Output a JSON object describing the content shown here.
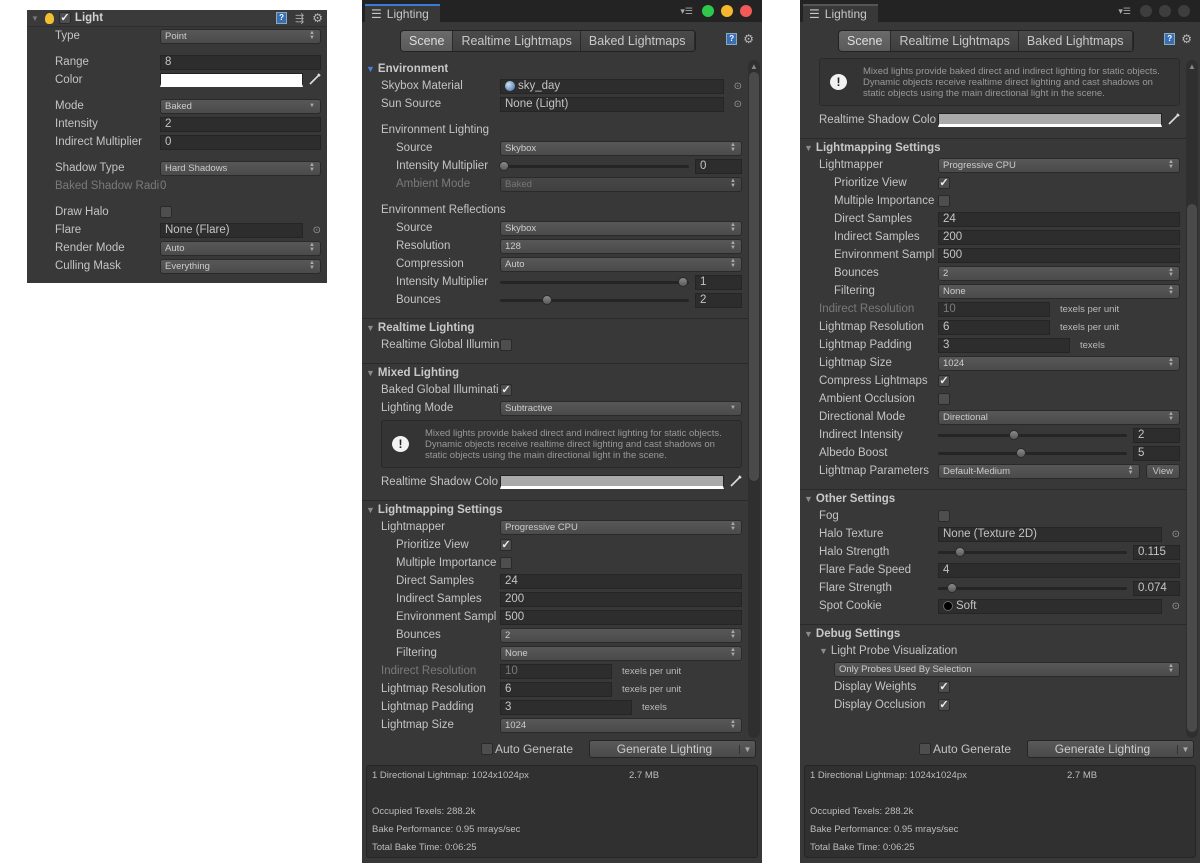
{
  "colors": {
    "accent": "#3b7bd6",
    "close": "#f25a58",
    "minimize": "#f5b72e",
    "maximize": "#2fc84a"
  },
  "inspector": {
    "title": "Light",
    "enabled": true,
    "icons": [
      "foldout-icon",
      "light-bulb-icon",
      "help-book-icon",
      "preset-icon",
      "gear-icon"
    ],
    "rows": [
      {
        "type": "dropdown",
        "label": "Type",
        "indent": 0,
        "value": "Point",
        "arrow": "updown"
      },
      {
        "type": "space"
      },
      {
        "type": "field",
        "label": "Range",
        "indent": 0,
        "value": "8"
      },
      {
        "type": "color",
        "label": "Color",
        "indent": 0,
        "color": "#ffffff"
      },
      {
        "type": "space"
      },
      {
        "type": "dropdown",
        "label": "Mode",
        "indent": 0,
        "value": "Baked",
        "arrow": "down"
      },
      {
        "type": "field",
        "label": "Intensity",
        "indent": 0,
        "value": "2"
      },
      {
        "type": "field",
        "label": "Indirect Multiplier",
        "indent": 0,
        "value": "0"
      },
      {
        "type": "space"
      },
      {
        "type": "dropdown",
        "label": "Shadow Type",
        "indent": 0,
        "value": "Hard Shadows",
        "arrow": "updown"
      },
      {
        "type": "field",
        "label": "Baked Shadow Radi",
        "indent": 1,
        "value": "0",
        "disabled": true,
        "plain": true
      },
      {
        "type": "space"
      },
      {
        "type": "checkbox",
        "label": "Draw Halo",
        "indent": 0,
        "checked": false
      },
      {
        "type": "object",
        "label": "Flare",
        "indent": 0,
        "value": "None (Flare)"
      },
      {
        "type": "dropdown",
        "label": "Render Mode",
        "indent": 0,
        "value": "Auto",
        "arrow": "updown"
      },
      {
        "type": "dropdown",
        "label": "Culling Mask",
        "indent": 0,
        "value": "Everything",
        "arrow": "updown"
      }
    ]
  },
  "mid": {
    "window_tab": "Lighting",
    "tabs": [
      "Scene",
      "Realtime Lightmaps",
      "Baked Lightmaps"
    ],
    "active_tab": "Scene",
    "scroll": {
      "position": 0.0,
      "visible_fraction": 0.62
    },
    "rows": [
      {
        "type": "header",
        "label": "Environment",
        "active": true
      },
      {
        "type": "object",
        "label": "Skybox Material",
        "indent": 1,
        "value": "sky_day",
        "icon": "material-sphere-icon"
      },
      {
        "type": "object",
        "label": "Sun Source",
        "indent": 1,
        "value": "None (Light)"
      },
      {
        "type": "space"
      },
      {
        "type": "label",
        "label": "Environment Lighting",
        "indent": 1
      },
      {
        "type": "dropdown",
        "label": "Source",
        "indent": 2,
        "value": "Skybox",
        "arrow": "updown"
      },
      {
        "type": "slider",
        "label": "Intensity Multiplier",
        "indent": 2,
        "value": "0",
        "position": 0.0
      },
      {
        "type": "dropdown",
        "label": "Ambient Mode",
        "indent": 2,
        "value": "Baked",
        "arrow": "updown",
        "disabled": true
      },
      {
        "type": "space"
      },
      {
        "type": "label",
        "label": "Environment Reflections",
        "indent": 1
      },
      {
        "type": "dropdown",
        "label": "Source",
        "indent": 2,
        "value": "Skybox",
        "arrow": "updown"
      },
      {
        "type": "dropdown",
        "label": "Resolution",
        "indent": 2,
        "value": "128",
        "arrow": "updown"
      },
      {
        "type": "dropdown",
        "label": "Compression",
        "indent": 2,
        "value": "Auto",
        "arrow": "updown"
      },
      {
        "type": "slider",
        "label": "Intensity Multiplier",
        "indent": 2,
        "value": "1",
        "position": 0.97
      },
      {
        "type": "slider",
        "label": "Bounces",
        "indent": 2,
        "value": "2",
        "position": 0.25
      },
      {
        "type": "header",
        "label": "Realtime Lighting"
      },
      {
        "type": "checkbox",
        "label": "Realtime Global Illumin",
        "indent": 1,
        "checked": false
      },
      {
        "type": "header",
        "label": "Mixed Lighting"
      },
      {
        "type": "checkbox",
        "label": "Baked Global Illuminati",
        "indent": 1,
        "checked": true
      },
      {
        "type": "dropdown",
        "label": "Lighting Mode",
        "indent": 1,
        "value": "Subtractive",
        "arrow": "down"
      },
      {
        "type": "helpbox",
        "text": "Mixed lights provide baked direct and indirect lighting for static objects. Dynamic objects receive realtime direct lighting and cast shadows on static objects using the main directional light in the scene."
      },
      {
        "type": "color",
        "label": "Realtime Shadow Colo",
        "indent": 1,
        "color": "#a9a9a9"
      },
      {
        "type": "header",
        "label": "Lightmapping Settings"
      },
      {
        "type": "dropdown",
        "label": "Lightmapper",
        "indent": 1,
        "value": "Progressive CPU",
        "arrow": "updown"
      },
      {
        "type": "checkbox",
        "label": "Prioritize View",
        "indent": 2,
        "checked": true
      },
      {
        "type": "checkbox",
        "label": "Multiple Importance",
        "indent": 2,
        "checked": false
      },
      {
        "type": "field",
        "label": "Direct Samples",
        "indent": 2,
        "value": "24"
      },
      {
        "type": "field",
        "label": "Indirect Samples",
        "indent": 2,
        "value": "200"
      },
      {
        "type": "field",
        "label": "Environment Sampl",
        "indent": 2,
        "value": "500"
      },
      {
        "type": "dropdown",
        "label": "Bounces",
        "indent": 2,
        "value": "2",
        "arrow": "updown"
      },
      {
        "type": "dropdown",
        "label": "Filtering",
        "indent": 2,
        "value": "None",
        "arrow": "updown"
      },
      {
        "type": "field",
        "label": "Indirect Resolution",
        "indent": 1,
        "value": "10",
        "unit": "texels per unit",
        "disabled": true
      },
      {
        "type": "field",
        "label": "Lightmap Resolution",
        "indent": 1,
        "value": "6",
        "unit": "texels per unit"
      },
      {
        "type": "field",
        "label": "Lightmap Padding",
        "indent": 1,
        "value": "3",
        "unit": "texels"
      },
      {
        "type": "dropdown",
        "label": "Lightmap Size",
        "indent": 1,
        "value": "1024",
        "arrow": "updown"
      }
    ],
    "bottom": {
      "auto_generate_label": "Auto Generate",
      "auto_generate": false,
      "generate_label": "Generate Lighting",
      "info": {
        "lightmaps": "1 Directional Lightmap: 1024x1024px",
        "size": "2.7 MB",
        "texels": "Occupied Texels: 288.2k",
        "performance": "Bake Performance: 0.95 mrays/sec",
        "time": "Total Bake Time: 0:06:25"
      }
    }
  },
  "right": {
    "window_tab": "Lighting",
    "tabs": [
      "Scene",
      "Realtime Lightmaps",
      "Baked Lightmaps"
    ],
    "active_tab": "Scene",
    "scroll": {
      "position": 0.2,
      "visible_fraction": 0.8
    },
    "rows": [
      {
        "type": "helpbox",
        "text": "Mixed lights provide baked direct and indirect lighting for static objects. Dynamic objects receive realtime direct lighting and cast shadows on static objects using the main directional light in the scene."
      },
      {
        "type": "color",
        "label": "Realtime Shadow Colo",
        "indent": 1,
        "color": "#a9a9a9"
      },
      {
        "type": "header",
        "label": "Lightmapping Settings"
      },
      {
        "type": "dropdown",
        "label": "Lightmapper",
        "indent": 1,
        "value": "Progressive CPU",
        "arrow": "updown"
      },
      {
        "type": "checkbox",
        "label": "Prioritize View",
        "indent": 2,
        "checked": true
      },
      {
        "type": "checkbox",
        "label": "Multiple Importance",
        "indent": 2,
        "checked": false
      },
      {
        "type": "field",
        "label": "Direct Samples",
        "indent": 2,
        "value": "24"
      },
      {
        "type": "field",
        "label": "Indirect Samples",
        "indent": 2,
        "value": "200"
      },
      {
        "type": "field",
        "label": "Environment Sampl",
        "indent": 2,
        "value": "500"
      },
      {
        "type": "dropdown",
        "label": "Bounces",
        "indent": 2,
        "value": "2",
        "arrow": "updown"
      },
      {
        "type": "dropdown",
        "label": "Filtering",
        "indent": 2,
        "value": "None",
        "arrow": "updown"
      },
      {
        "type": "field",
        "label": "Indirect Resolution",
        "indent": 1,
        "value": "10",
        "unit": "texels per unit",
        "disabled": true
      },
      {
        "type": "field",
        "label": "Lightmap Resolution",
        "indent": 1,
        "value": "6",
        "unit": "texels per unit"
      },
      {
        "type": "field",
        "label": "Lightmap Padding",
        "indent": 1,
        "value": "3",
        "unit": "texels"
      },
      {
        "type": "dropdown",
        "label": "Lightmap Size",
        "indent": 1,
        "value": "1024",
        "arrow": "updown"
      },
      {
        "type": "checkbox",
        "label": "Compress Lightmaps",
        "indent": 1,
        "checked": true
      },
      {
        "type": "checkbox",
        "label": "Ambient Occlusion",
        "indent": 1,
        "checked": false
      },
      {
        "type": "dropdown",
        "label": "Directional Mode",
        "indent": 1,
        "value": "Directional",
        "arrow": "updown"
      },
      {
        "type": "slider",
        "label": "Indirect Intensity",
        "indent": 1,
        "value": "2",
        "position": 0.4
      },
      {
        "type": "slider",
        "label": "Albedo Boost",
        "indent": 1,
        "value": "5",
        "position": 0.44
      },
      {
        "type": "dropdown",
        "label": "Lightmap Parameters",
        "indent": 1,
        "value": "Default-Medium",
        "arrow": "updown",
        "button": "View"
      },
      {
        "type": "header",
        "label": "Other Settings"
      },
      {
        "type": "checkbox",
        "label": "Fog",
        "indent": 1,
        "checked": false
      },
      {
        "type": "object",
        "label": "Halo Texture",
        "indent": 1,
        "value": "None (Texture 2D)"
      },
      {
        "type": "slider",
        "label": "Halo Strength",
        "indent": 1,
        "value": "0.115",
        "position": 0.115
      },
      {
        "type": "field",
        "label": "Flare Fade Speed",
        "indent": 1,
        "value": "4"
      },
      {
        "type": "slider",
        "label": "Flare Strength",
        "indent": 1,
        "value": "0.074",
        "position": 0.074
      },
      {
        "type": "object",
        "label": "Spot Cookie",
        "indent": 1,
        "value": "Soft",
        "icon": "texture-icon"
      },
      {
        "type": "header",
        "label": "Debug Settings"
      },
      {
        "type": "foldout",
        "label": "Light Probe Visualization",
        "indent": 1
      },
      {
        "type": "dropdown",
        "indent": 2,
        "value": "Only Probes Used By Selection",
        "arrow": "updown"
      },
      {
        "type": "checkbox",
        "label": "Display Weights",
        "indent": 2,
        "checked": true
      },
      {
        "type": "checkbox",
        "label": "Display Occlusion",
        "indent": 2,
        "checked": true
      }
    ],
    "bottom": {
      "auto_generate_label": "Auto Generate",
      "auto_generate": false,
      "generate_label": "Generate Lighting",
      "info": {
        "lightmaps": "1 Directional Lightmap: 1024x1024px",
        "size": "2.7 MB",
        "texels": "Occupied Texels: 288.2k",
        "performance": "Bake Performance: 0.95 mrays/sec",
        "time": "Total Bake Time: 0:06:25"
      }
    }
  }
}
